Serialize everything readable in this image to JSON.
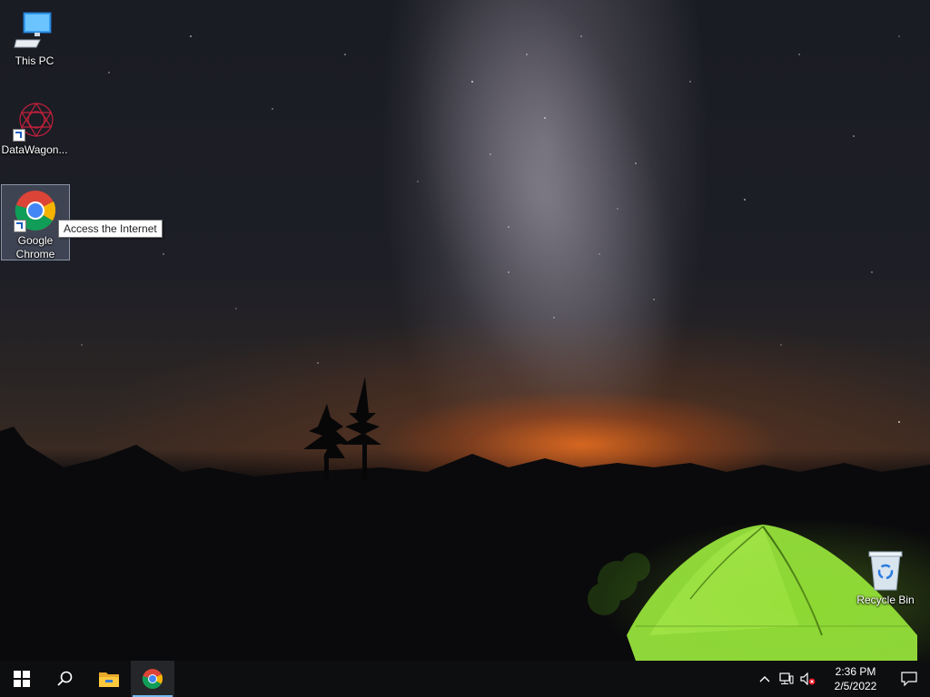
{
  "desktop": {
    "icons": [
      {
        "label": "This PC",
        "icon": "computer-icon"
      },
      {
        "label": "DataWagon...",
        "icon": "datawagon-icon"
      },
      {
        "label": "Google Chrome",
        "icon": "chrome-icon",
        "selected": true
      },
      {
        "label": "Recycle Bin",
        "icon": "recycle-bin-icon"
      }
    ],
    "tooltip": "Access the Internet"
  },
  "taskbar": {
    "start_icon": "windows-logo-icon",
    "search_icon": "search-icon",
    "pinned": [
      {
        "icon": "file-explorer-icon"
      },
      {
        "icon": "chrome-icon",
        "active": true
      }
    ],
    "tray": {
      "icons": [
        "chevron-up-icon",
        "network-icon",
        "volume-muted-icon"
      ],
      "time": "2:36 PM",
      "date": "2/5/2022",
      "notification_icon": "action-center-icon"
    }
  },
  "colors": {
    "taskbar_bg": "#0d0e10",
    "active_indicator": "#76b9ed",
    "tent_green": "#8fd63a"
  }
}
